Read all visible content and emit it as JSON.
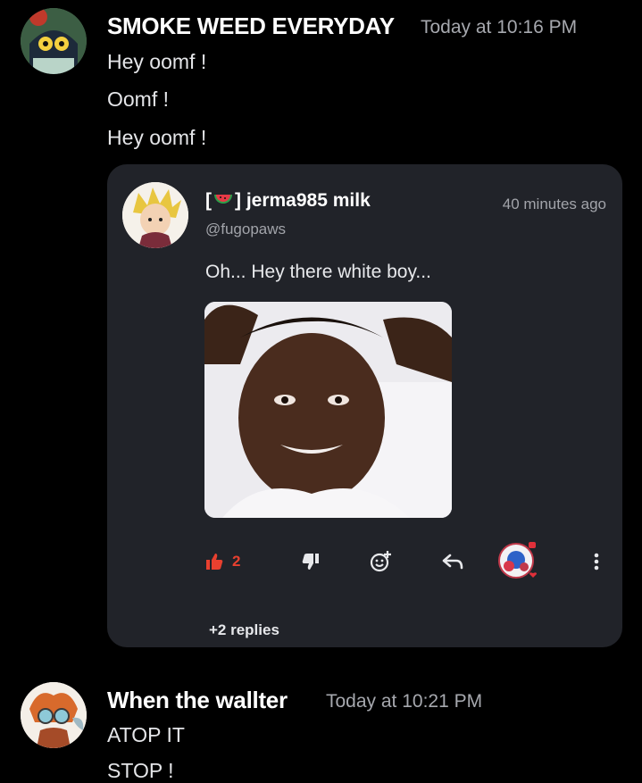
{
  "messages": [
    {
      "author": "SMOKE WEED EVERYDAY",
      "timestamp": "Today at 10:16 PM",
      "lines": [
        "Hey oomf !",
        "Oomf !",
        "Hey oomf !"
      ]
    },
    {
      "author": "When the wallter",
      "timestamp": "Today at 10:21 PM",
      "lines": [
        "ATOP IT",
        "STOP !"
      ]
    }
  ],
  "embed": {
    "author_name": "] jerma985 milk",
    "author_prefix_bracket": "[",
    "handle": "@fugopaws",
    "time_ago": "40 minutes ago",
    "text": "Oh... Hey there white boy...",
    "like_count": "2",
    "replies": "+2 replies",
    "icons": [
      "thumbs-up-icon",
      "thumbs-down-icon",
      "add-reaction-icon",
      "reply-icon",
      "reactor-avatar",
      "more-options-icon"
    ]
  },
  "colors": {
    "background": "#000000",
    "embed_bg": "#212329",
    "like_red": "#e8402f",
    "muted_text": "#a6a8ae"
  }
}
